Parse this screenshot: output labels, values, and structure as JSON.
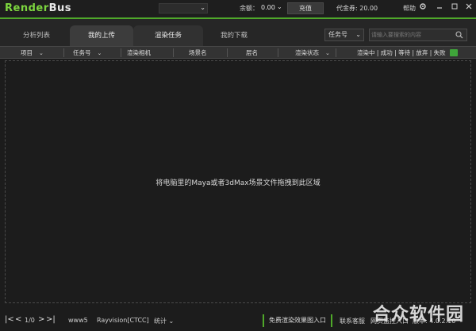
{
  "titlebar": {
    "logo_part1": "Render",
    "logo_part2": "Bus",
    "account_value": "",
    "balance_label": "余额：",
    "balance_value": "0.00",
    "recharge_label": "充值",
    "coupon_label": "代金券: 20.00",
    "help_label": "帮助"
  },
  "tabs": [
    {
      "label": "分析列表"
    },
    {
      "label": "我的上传"
    },
    {
      "label": "渲染任务"
    },
    {
      "label": "我的下载"
    }
  ],
  "filter": {
    "selected": "任务号"
  },
  "search": {
    "placeholder": "请输入要搜索的内容"
  },
  "columns": {
    "project": "项目",
    "task_no": "任务号",
    "camera": "渲染相机",
    "scene": "场景名",
    "layer": "层名",
    "status": "渲染状态",
    "stats": "渲染中 | 成功 | 等待 | 放弃 | 失败"
  },
  "main": {
    "drop_hint": "将电脑里的Maya或者3dMax场景文件拖拽到此区域"
  },
  "bottom": {
    "page": "1/0",
    "user": "www5",
    "region": "Rayvision[CTCC]",
    "stats_label": "统计",
    "preview_link": "免费渲染效果图入口",
    "contact": "联系客服",
    "web_monitor": "网页监控入口",
    "version": "版本: 4.0.2.10"
  },
  "watermark": "合众软件园",
  "colors": {
    "accent_green": "#4fa82a",
    "logo_green": "#7dd63f",
    "background": "#1c1c1c"
  }
}
